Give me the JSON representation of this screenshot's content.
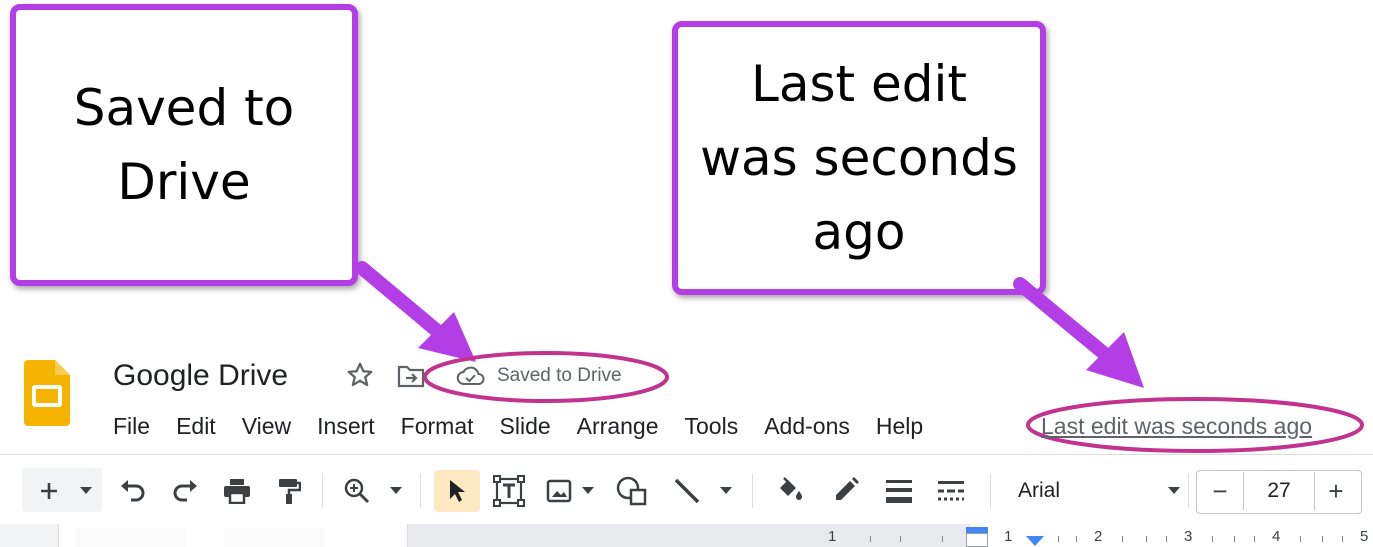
{
  "callouts": {
    "left_line1": "Saved to",
    "left_line2": "Drive",
    "right_line1": "Last edit",
    "right_line2": "was seconds",
    "right_line3": "ago"
  },
  "colors": {
    "callout_border": "#b43ee6",
    "arrow": "#b43ee6",
    "highlight_ellipse": "#c2338f",
    "slides_logo": "#f4b400"
  },
  "header": {
    "title": "Google Drive",
    "saved_status": "Saved to Drive",
    "last_edit": "Last edit was seconds ago",
    "icons": [
      "slides-logo-icon",
      "star-icon",
      "move-to-folder-icon",
      "cloud-done-icon"
    ]
  },
  "menu": [
    "File",
    "Edit",
    "View",
    "Insert",
    "Format",
    "Slide",
    "Arrange",
    "Tools",
    "Add-ons",
    "Help"
  ],
  "toolbar": {
    "icons": [
      "new-slide-icon",
      "new-slide-dropdown-icon",
      "undo-icon",
      "redo-icon",
      "print-icon",
      "paint-format-icon",
      "zoom-icon",
      "zoom-dropdown-icon",
      "select-icon",
      "text-box-icon",
      "image-icon",
      "image-dropdown-icon",
      "shape-icon",
      "line-icon",
      "line-dropdown-icon",
      "fill-color-icon",
      "border-color-icon",
      "border-weight-icon",
      "border-dash-icon"
    ],
    "font": "Arial",
    "font_size": "27",
    "decrease_label": "−",
    "increase_label": "+"
  },
  "ruler": {
    "numbers": [
      "1",
      "1",
      "2",
      "3",
      "4",
      "5"
    ]
  }
}
